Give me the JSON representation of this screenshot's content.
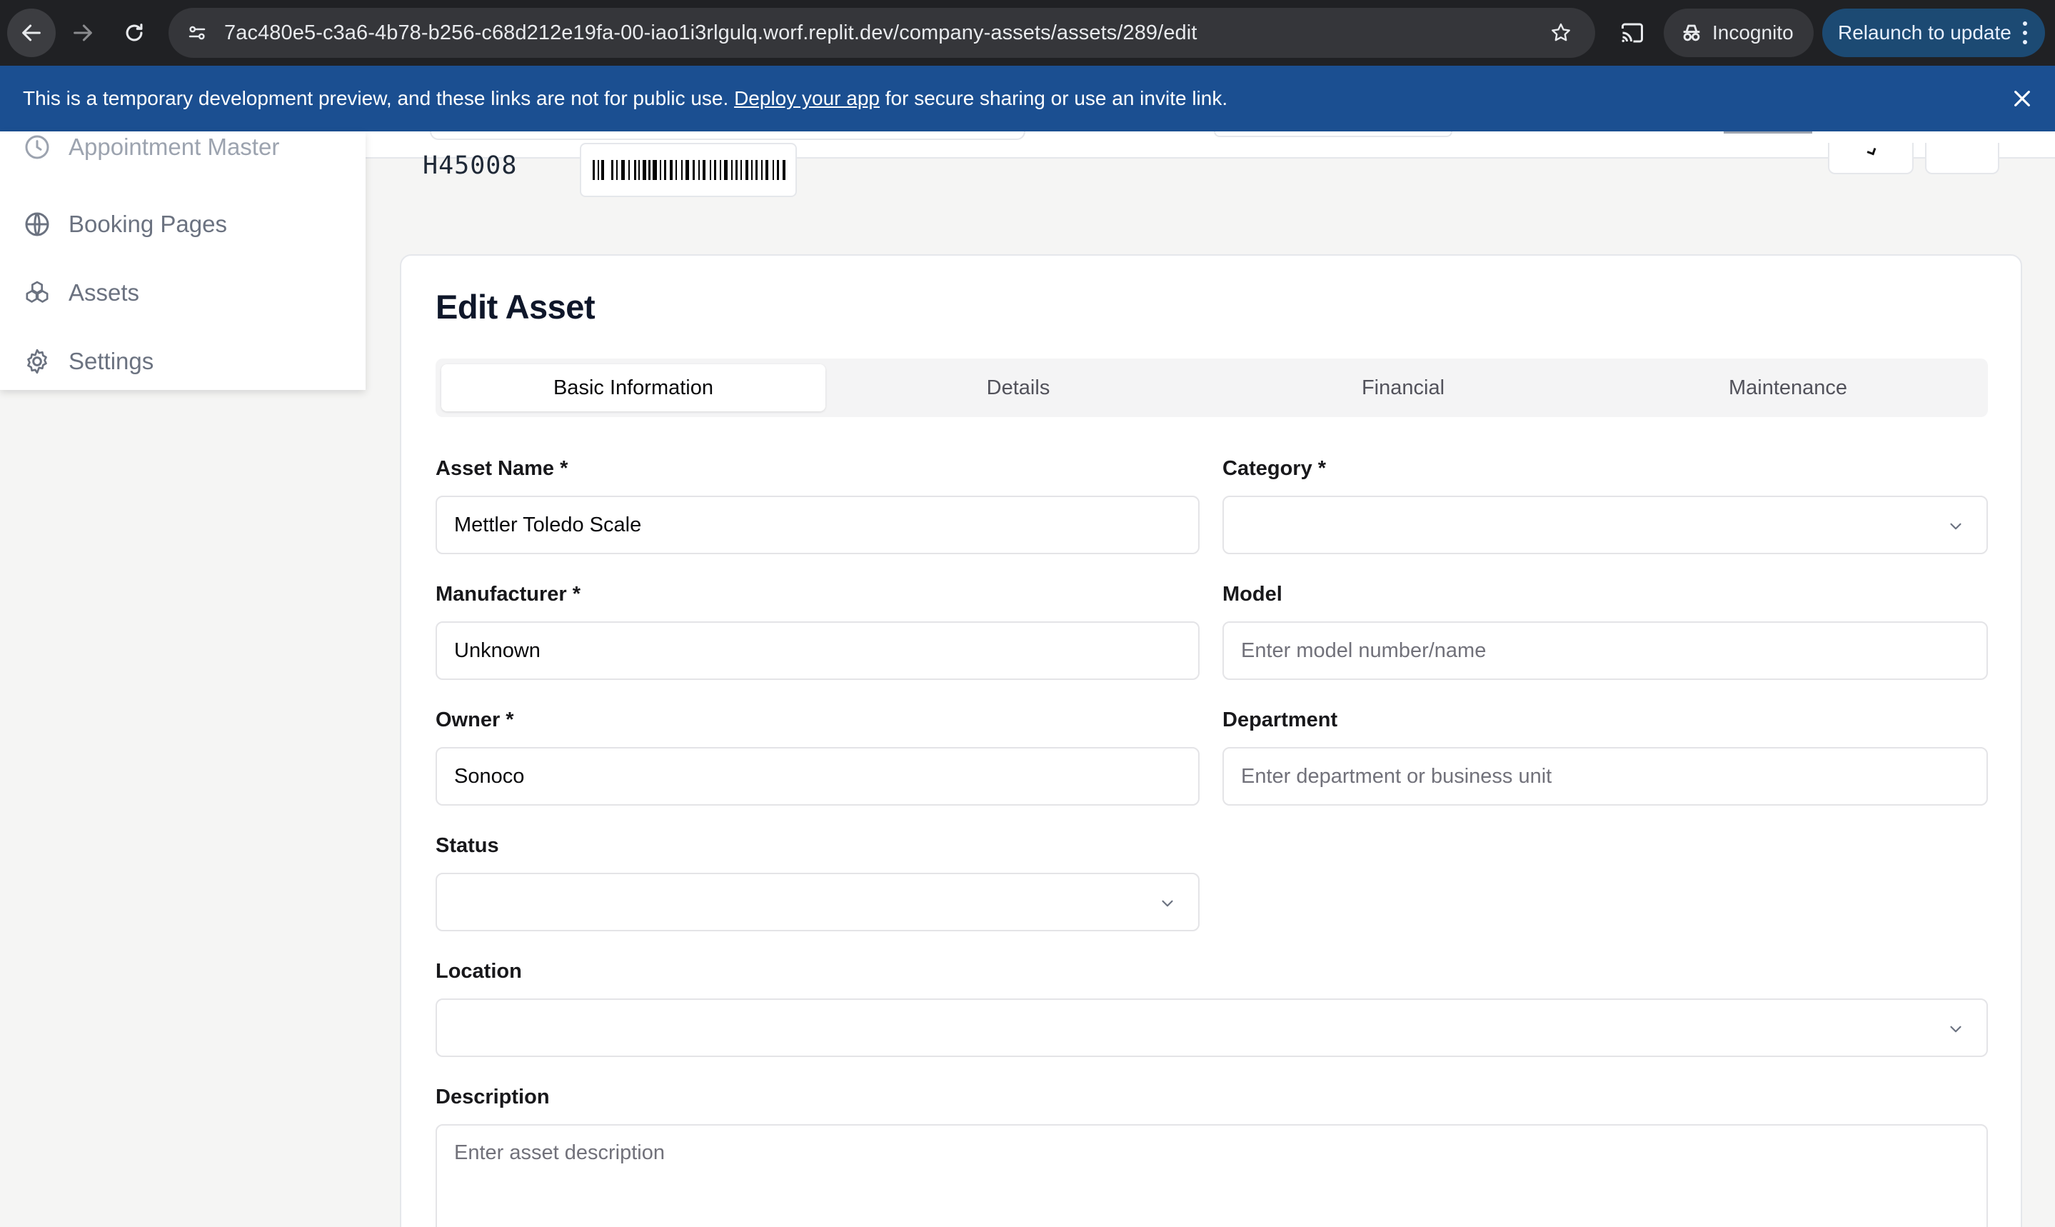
{
  "browser": {
    "url": "7ac480e5-c3a6-4b78-b256-c68d212e19fa-00-iao1i3rlgulq.worf.replit.dev/company-assets/assets/289/edit",
    "incognito_label": "Incognito",
    "relaunch_label": "Relaunch to update"
  },
  "banner": {
    "text_before": "This is a temporary development preview, and these links are not for public use. ",
    "link_text": "Deploy your app",
    "text_after": " for secure sharing or use an invite link."
  },
  "sidebar": {
    "items": [
      {
        "label": "Appointment Master",
        "icon": "calendar-clock-icon"
      },
      {
        "label": "Booking Pages",
        "icon": "globe-icon"
      },
      {
        "label": "Assets",
        "icon": "boxes-icon"
      },
      {
        "label": "Settings",
        "icon": "gear-icon"
      }
    ]
  },
  "asset": {
    "id": "H45008"
  },
  "form": {
    "title": "Edit Asset",
    "tabs": [
      {
        "label": "Basic Information",
        "active": true
      },
      {
        "label": "Details",
        "active": false
      },
      {
        "label": "Financial",
        "active": false
      },
      {
        "label": "Maintenance",
        "active": false
      }
    ],
    "fields": {
      "asset_name": {
        "label": "Asset Name *",
        "value": "Mettler Toledo Scale",
        "placeholder": ""
      },
      "category": {
        "label": "Category *",
        "value": ""
      },
      "manufacturer": {
        "label": "Manufacturer *",
        "value": "Unknown",
        "placeholder": ""
      },
      "model": {
        "label": "Model",
        "value": "",
        "placeholder": "Enter model number/name"
      },
      "owner": {
        "label": "Owner *",
        "value": "Sonoco",
        "placeholder": ""
      },
      "department": {
        "label": "Department",
        "value": "",
        "placeholder": "Enter department or business unit"
      },
      "status": {
        "label": "Status",
        "value": ""
      },
      "location": {
        "label": "Location",
        "value": ""
      },
      "description": {
        "label": "Description",
        "value": "",
        "placeholder": "Enter asset description"
      }
    }
  },
  "colors": {
    "banner_bg": "#1b4f91",
    "chrome_bg": "#202124",
    "page_bg": "#f5f5f4",
    "relaunch_bg": "#1c4a73"
  }
}
